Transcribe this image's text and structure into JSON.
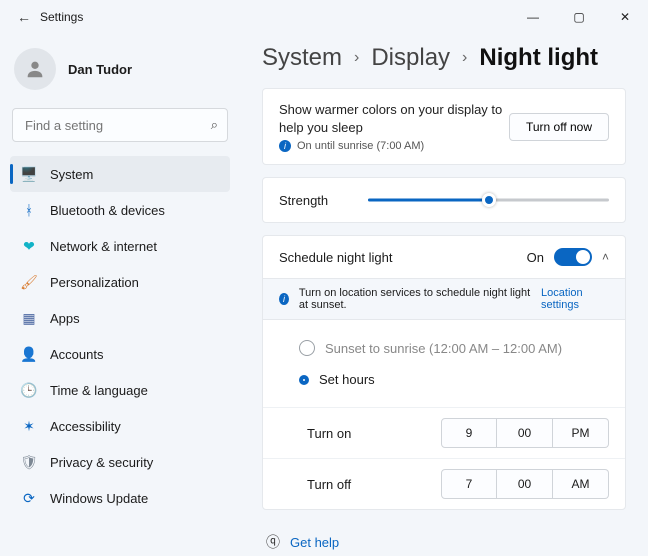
{
  "window": {
    "title": "Settings"
  },
  "user": {
    "name": "Dan Tudor"
  },
  "search": {
    "placeholder": "Find a setting"
  },
  "sidebar": [
    {
      "icon": "🖥️",
      "label": "System",
      "color": "#0a66c2",
      "active": true
    },
    {
      "icon": "ᚼ",
      "label": "Bluetooth & devices",
      "color": "#0a66c2"
    },
    {
      "icon": "❤",
      "label": "Network & internet",
      "color": "#12b3c7"
    },
    {
      "icon": "🖌",
      "label": "Personalization",
      "color": "#d97b2f"
    },
    {
      "icon": "▦",
      "label": "Apps",
      "color": "#4a66a0"
    },
    {
      "icon": "👤",
      "label": "Accounts",
      "color": "#2f9e55"
    },
    {
      "icon": "🕒",
      "label": "Time & language",
      "color": "#555"
    },
    {
      "icon": "✶",
      "label": "Accessibility",
      "color": "#0a66c2"
    },
    {
      "icon": "🛡",
      "label": "Privacy & security",
      "color": "#7d8894"
    },
    {
      "icon": "⟳",
      "label": "Windows Update",
      "color": "#0a66c2"
    }
  ],
  "breadcrumb": {
    "a": "System",
    "b": "Display",
    "c": "Night light"
  },
  "intro": {
    "text": "Show warmer colors on your display to help you sleep",
    "status": "On until sunrise (7:00 AM)",
    "button": "Turn off now"
  },
  "strength": {
    "label": "Strength",
    "percent": 50
  },
  "schedule": {
    "label": "Schedule night light",
    "state": "On",
    "infobar": "Turn on location services to schedule night light at sunset.",
    "link": "Location settings",
    "option_sunset": "Sunset to sunrise (12:00 AM – 12:00 AM)",
    "option_hours": "Set hours",
    "turn_on": {
      "label": "Turn on",
      "h": "9",
      "m": "00",
      "ampm": "PM"
    },
    "turn_off": {
      "label": "Turn off",
      "h": "7",
      "m": "00",
      "ampm": "AM"
    }
  },
  "help": "Get help"
}
